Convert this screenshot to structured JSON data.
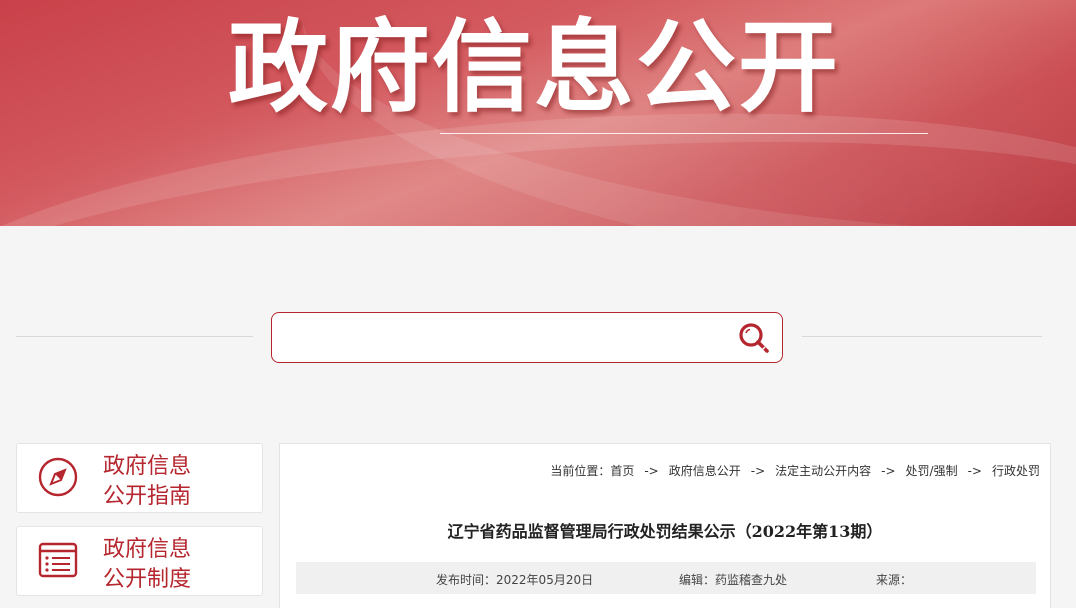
{
  "banner": {
    "title": "政府信息公开"
  },
  "search": {
    "value": "",
    "placeholder": ""
  },
  "sidebar": {
    "items": [
      {
        "line1": "政府信息",
        "line2": "公开指南",
        "icon": "compass-icon"
      },
      {
        "line1": "政府信息",
        "line2": "公开制度",
        "icon": "list-document-icon"
      }
    ]
  },
  "breadcrumb": {
    "label": "当前位置：",
    "separator": "->",
    "items": [
      "首页",
      "政府信息公开",
      "法定主动公开内容",
      "处罚/强制",
      "行政处罚"
    ]
  },
  "article": {
    "title": "辽宁省药品监督管理局行政处罚结果公示（2022年第13期）",
    "publish_time_label": "发布时间：",
    "publish_time": "2022年05月20日",
    "editor_label": "编辑：",
    "editor": "药监稽查九处",
    "source_label": "来源：",
    "source": ""
  },
  "colors": {
    "accent": "#b5262e",
    "banner": "#c9414a"
  }
}
